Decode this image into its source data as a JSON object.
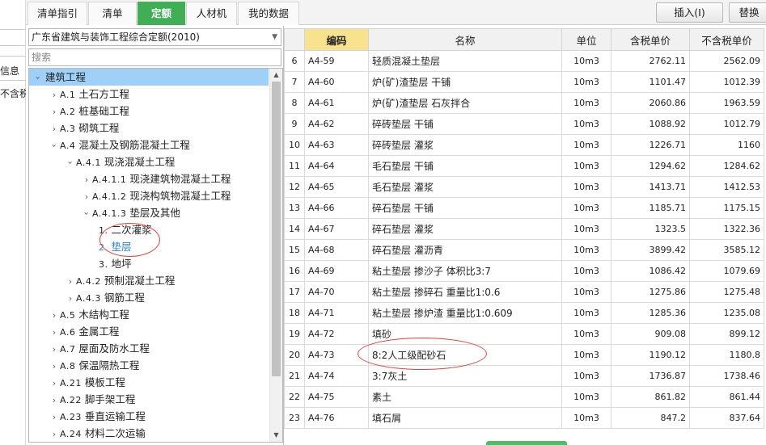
{
  "left_strip": {
    "label_info": "信息",
    "label_tax": "不含税"
  },
  "tabs": [
    {
      "label": "清单指引",
      "active": false
    },
    {
      "label": "清单",
      "active": false
    },
    {
      "label": "定额",
      "active": true
    },
    {
      "label": "人材机",
      "active": false
    },
    {
      "label": "我的数据",
      "active": false
    }
  ],
  "toolbar": {
    "insert_label": "插入(I)",
    "replace_label": "替换"
  },
  "quota_select": {
    "value": "广东省建筑与装饰工程综合定额(2010)"
  },
  "search": {
    "placeholder": "搜索"
  },
  "tree": [
    {
      "code": "",
      "label": "建筑工程",
      "depth": 0,
      "chev": "down",
      "selected": true
    },
    {
      "code": "A.1",
      "label": "土石方工程",
      "depth": 1,
      "chev": "right"
    },
    {
      "code": "A.2",
      "label": "桩基础工程",
      "depth": 1,
      "chev": "right"
    },
    {
      "code": "A.3",
      "label": "砌筑工程",
      "depth": 1,
      "chev": "right"
    },
    {
      "code": "A.4",
      "label": "混凝土及钢筋混凝土工程",
      "depth": 1,
      "chev": "down"
    },
    {
      "code": "A.4.1",
      "label": "现浇混凝土工程",
      "depth": 2,
      "chev": "down"
    },
    {
      "code": "A.4.1.1",
      "label": "现浇建筑物混凝土工程",
      "depth": 3,
      "chev": "right"
    },
    {
      "code": "A.4.1.2",
      "label": "现浇构筑物混凝土工程",
      "depth": 3,
      "chev": "right"
    },
    {
      "code": "A.4.1.3",
      "label": "垫层及其他",
      "depth": 3,
      "chev": "down"
    },
    {
      "code": "1.",
      "label": "二次灌浆",
      "depth": 4,
      "chev": ""
    },
    {
      "code": "2.",
      "label": "垫层",
      "depth": 4,
      "chev": "",
      "active": true
    },
    {
      "code": "3.",
      "label": "地坪",
      "depth": 4,
      "chev": ""
    },
    {
      "code": "A.4.2",
      "label": "预制混凝土工程",
      "depth": 2,
      "chev": "right"
    },
    {
      "code": "A.4.3",
      "label": "钢筋工程",
      "depth": 2,
      "chev": "right"
    },
    {
      "code": "A.5",
      "label": "木结构工程",
      "depth": 1,
      "chev": "right"
    },
    {
      "code": "A.6",
      "label": "金属工程",
      "depth": 1,
      "chev": "right"
    },
    {
      "code": "A.7",
      "label": "屋面及防水工程",
      "depth": 1,
      "chev": "right"
    },
    {
      "code": "A.8",
      "label": "保温隔热工程",
      "depth": 1,
      "chev": "right"
    },
    {
      "code": "A.21",
      "label": "模板工程",
      "depth": 1,
      "chev": "right"
    },
    {
      "code": "A.22",
      "label": "脚手架工程",
      "depth": 1,
      "chev": "right"
    },
    {
      "code": "A.23",
      "label": "垂直运输工程",
      "depth": 1,
      "chev": "right"
    },
    {
      "code": "A.24",
      "label": "材料二次运输",
      "depth": 1,
      "chev": "right"
    }
  ],
  "table": {
    "headers": [
      "",
      "编码",
      "名称",
      "单位",
      "含税单价",
      "不含税单价"
    ],
    "rows": [
      [
        "6",
        "A4-59",
        "轻质混凝土垫层",
        "10m3",
        "2762.11",
        "2562.09"
      ],
      [
        "7",
        "A4-60",
        "炉(矿)渣垫层 干铺",
        "10m3",
        "1101.47",
        "1012.39"
      ],
      [
        "8",
        "A4-61",
        "炉(矿)渣垫层 石灰拌合",
        "10m3",
        "2060.86",
        "1963.59"
      ],
      [
        "9",
        "A4-62",
        "碎砖垫层 干铺",
        "10m3",
        "1088.92",
        "1012.79"
      ],
      [
        "10",
        "A4-63",
        "碎砖垫层 灌浆",
        "10m3",
        "1226.71",
        "1160"
      ],
      [
        "11",
        "A4-64",
        "毛石垫层 干铺",
        "10m3",
        "1294.62",
        "1284.62"
      ],
      [
        "12",
        "A4-65",
        "毛石垫层 灌浆",
        "10m3",
        "1413.71",
        "1412.53"
      ],
      [
        "13",
        "A4-66",
        "碎石垫层 干铺",
        "10m3",
        "1185.71",
        "1175.15"
      ],
      [
        "14",
        "A4-67",
        "碎石垫层 灌浆",
        "10m3",
        "1323.5",
        "1322.36"
      ],
      [
        "15",
        "A4-68",
        "碎石垫层 灌沥青",
        "10m3",
        "3899.42",
        "3585.12"
      ],
      [
        "16",
        "A4-69",
        "粘土垫层 掺沙子 体积比3:7",
        "10m3",
        "1086.42",
        "1079.69"
      ],
      [
        "17",
        "A4-70",
        "粘土垫层 掺碎石 重量比1:0.6",
        "10m3",
        "1275.86",
        "1275.48"
      ],
      [
        "18",
        "A4-71",
        "粘土垫层 掺炉渣 重量比1:0.609",
        "10m3",
        "1285.36",
        "1235.08"
      ],
      [
        "19",
        "A4-72",
        "填砂",
        "10m3",
        "909.08",
        "899.12"
      ],
      [
        "20",
        "A4-73",
        "8:2人工级配砂石",
        "10m3",
        "1190.12",
        "1180.8"
      ],
      [
        "21",
        "A4-74",
        "3:7灰土",
        "10m3",
        "1736.87",
        "1738.46"
      ],
      [
        "22",
        "A4-75",
        "素土",
        "10m3",
        "861.82",
        "861.44"
      ],
      [
        "23",
        "A4-76",
        "填石屑",
        "10m3",
        "847.2",
        "837.64"
      ]
    ]
  }
}
